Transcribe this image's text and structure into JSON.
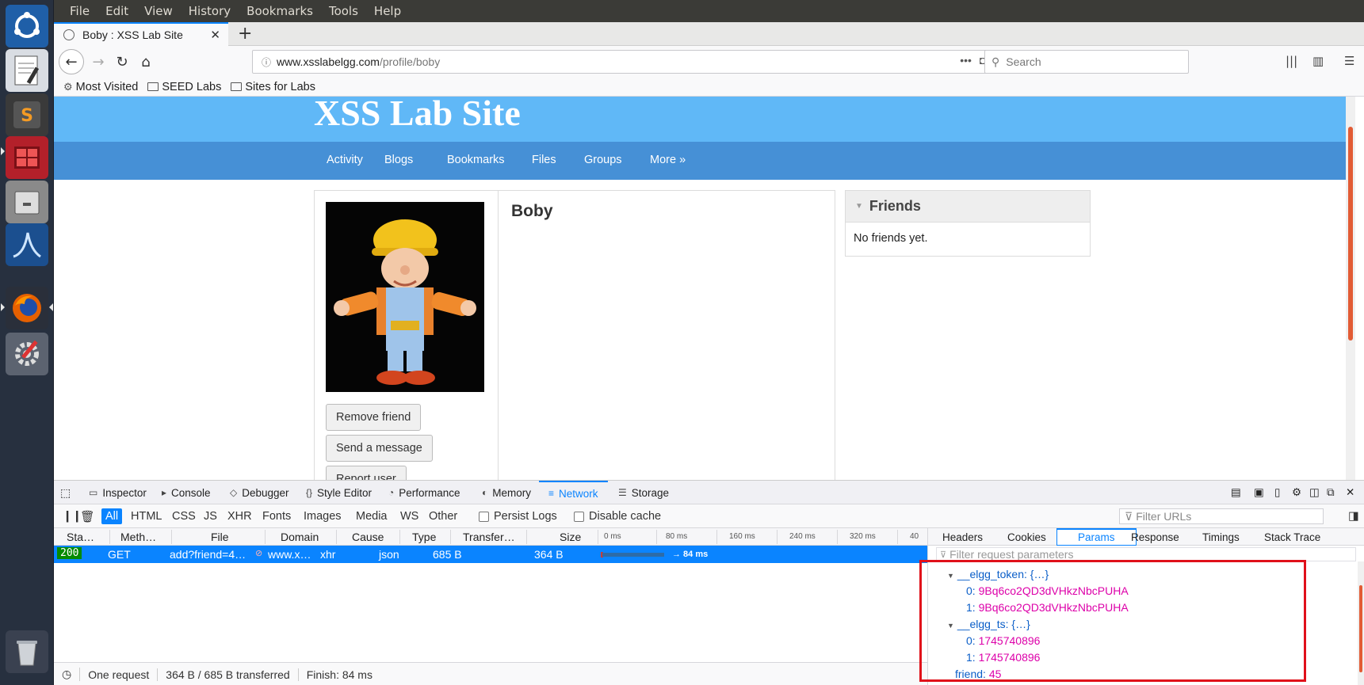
{
  "menubar": {
    "items": [
      {
        "label": "File"
      },
      {
        "label": "Edit"
      },
      {
        "label": "View"
      },
      {
        "label": "History"
      },
      {
        "label": "Bookmarks"
      },
      {
        "label": "Tools"
      },
      {
        "label": "Help"
      }
    ]
  },
  "tab": {
    "title": "Boby : XSS Lab Site",
    "close": "✕",
    "new_tab": "+"
  },
  "nav": {
    "url_host": "www.xsslabelgg.com",
    "url_path": "/profile/boby",
    "search_placeholder": "Search"
  },
  "bookmarks": {
    "items": [
      {
        "label": "Most Visited",
        "icon": "gear-icon"
      },
      {
        "label": "SEED Labs",
        "icon": "folder-icon"
      },
      {
        "label": "Sites for Labs",
        "icon": "folder-icon"
      }
    ]
  },
  "site": {
    "title": "XSS Lab Site",
    "nav": [
      {
        "label": "Activity"
      },
      {
        "label": "Blogs"
      },
      {
        "label": "Bookmarks"
      },
      {
        "label": "Files"
      },
      {
        "label": "Groups"
      },
      {
        "label": "More »"
      }
    ]
  },
  "profile": {
    "name": "Boby",
    "buttons": {
      "remove_friend": "Remove friend",
      "send_message": "Send a message",
      "report_user": "Report user"
    }
  },
  "friends": {
    "title": "Friends",
    "empty": "No friends yet."
  },
  "devtools": {
    "tabs": [
      {
        "label": "Inspector"
      },
      {
        "label": "Console"
      },
      {
        "label": "Debugger"
      },
      {
        "label": "Style Editor"
      },
      {
        "label": "Performance"
      },
      {
        "label": "Memory"
      },
      {
        "label": "Network"
      },
      {
        "label": "Storage"
      }
    ],
    "active_tab": "Network",
    "filters": [
      {
        "label": "All"
      },
      {
        "label": "HTML"
      },
      {
        "label": "CSS"
      },
      {
        "label": "JS"
      },
      {
        "label": "XHR"
      },
      {
        "label": "Fonts"
      },
      {
        "label": "Images"
      },
      {
        "label": "Media"
      },
      {
        "label": "WS"
      },
      {
        "label": "Other"
      }
    ],
    "persist_logs": "Persist Logs",
    "disable_cache": "Disable cache",
    "filter_urls_placeholder": "Filter URLs",
    "columns": {
      "status": "Sta…",
      "method": "Meth…",
      "file": "File",
      "domain": "Domain",
      "cause": "Cause",
      "type": "Type",
      "transferred": "Transfer…",
      "size": "Size"
    },
    "timeline_ticks": [
      "0 ms",
      "80 ms",
      "160 ms",
      "240 ms",
      "320 ms",
      "40"
    ],
    "request": {
      "status": "200",
      "method": "GET",
      "file": "add?friend=4…",
      "domain": "www.x…",
      "cause": "xhr",
      "type": "json",
      "transferred": "685 B",
      "size": "364 B",
      "timing": "→ 84 ms"
    },
    "status_bar": {
      "count": "One request",
      "transfer": "364 B / 685 B transferred",
      "finish": "Finish: 84 ms"
    },
    "side_tabs": [
      {
        "label": "Headers"
      },
      {
        "label": "Cookies"
      },
      {
        "label": "Params"
      },
      {
        "label": "Response"
      },
      {
        "label": "Timings"
      },
      {
        "label": "Stack Trace"
      }
    ],
    "active_side_tab": "Params",
    "filter_params_placeholder": "Filter request parameters",
    "params": {
      "token_key": "__elgg_token: {…}",
      "token_0_key": "0:",
      "token_0_val": "9Bq6co2QD3dVHkzNbcPUHA",
      "token_1_key": "1:",
      "token_1_val": "9Bq6co2QD3dVHkzNbcPUHA",
      "ts_key": "__elgg_ts: {…}",
      "ts_0_key": "0:",
      "ts_0_val": "1745740896",
      "ts_1_key": "1:",
      "ts_1_val": "1745740896",
      "friend_key": "friend:",
      "friend_val": "45"
    }
  },
  "colors": {
    "accent": "#0a84ff",
    "site_header": "#60b8f7",
    "site_nav": "#4690d6",
    "highlight": "#e0101a",
    "param_value": "#dd00a9"
  }
}
